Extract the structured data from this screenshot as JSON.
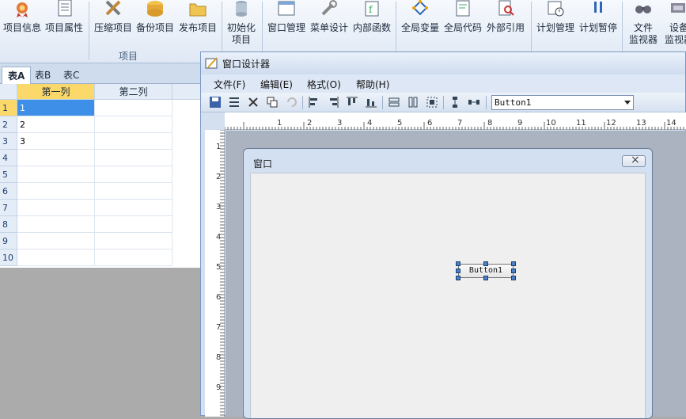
{
  "ribbon": {
    "buttons": [
      {
        "id": "project-info",
        "label": "项目信息",
        "icon": "ribbon-medal-icon"
      },
      {
        "id": "project-props",
        "label": "项目属性",
        "icon": "document-list-icon"
      },
      {
        "id": "compress-project",
        "label": "压缩项目",
        "icon": "tools-icon"
      },
      {
        "id": "backup-project",
        "label": "备份项目",
        "icon": "backup-icon"
      },
      {
        "id": "publish-project",
        "label": "发布项目",
        "icon": "folder-icon"
      },
      {
        "id": "init-project",
        "label": "初始化",
        "label2": "项目",
        "icon": "database-icon"
      },
      {
        "id": "window-manage",
        "label": "窗口管理",
        "icon": "window-icon"
      },
      {
        "id": "menu-design",
        "label": "菜单设计",
        "icon": "wrench-icon"
      },
      {
        "id": "inner-func",
        "label": "内部函数",
        "icon": "function-icon"
      },
      {
        "id": "global-var",
        "label": "全局变量",
        "icon": "diamond-nodes-icon"
      },
      {
        "id": "global-code",
        "label": "全局代码",
        "icon": "code-page-icon"
      },
      {
        "id": "external-ref",
        "label": "外部引用",
        "icon": "magnifier-icon"
      },
      {
        "id": "plan-manage",
        "label": "计划管理",
        "icon": "calendar-clock-icon"
      },
      {
        "id": "plan-pause",
        "label": "计划暂停",
        "icon": "pause-icon"
      },
      {
        "id": "file-monitor",
        "label": "文件",
        "label2": "监视器",
        "icon": "binoculars-icon"
      },
      {
        "id": "device-monitor",
        "label": "设备",
        "label2": "监视器",
        "icon": "device-icon"
      }
    ],
    "group_label": "项目"
  },
  "sheets": {
    "tabs": [
      "表A",
      "表B",
      "表C"
    ],
    "active": 0
  },
  "grid": {
    "columns": [
      "第一列",
      "第二列"
    ],
    "rows": [
      "1",
      "2",
      "3",
      "4",
      "5",
      "6",
      "7",
      "8",
      "9",
      "10"
    ],
    "cells": [
      "1",
      "2",
      "3"
    ]
  },
  "designer": {
    "title": "窗口设计器",
    "menu": [
      "文件(F)",
      "编辑(E)",
      "格式(O)",
      "帮助(H)"
    ],
    "component_combo": "Button1",
    "ruler_h": [
      "1",
      "2",
      "3",
      "4",
      "5",
      "6",
      "7",
      "8",
      "9",
      "10",
      "11",
      "12",
      "13",
      "14"
    ],
    "ruler_v": [
      "1",
      "2",
      "3",
      "4",
      "5",
      "6",
      "7",
      "8",
      "9"
    ],
    "form_title": "窗口",
    "button_text": "Button1"
  },
  "colors": {
    "selection": "#3d8fe8",
    "header_selected": "#fbd86a",
    "handle": "#4a80c8"
  }
}
